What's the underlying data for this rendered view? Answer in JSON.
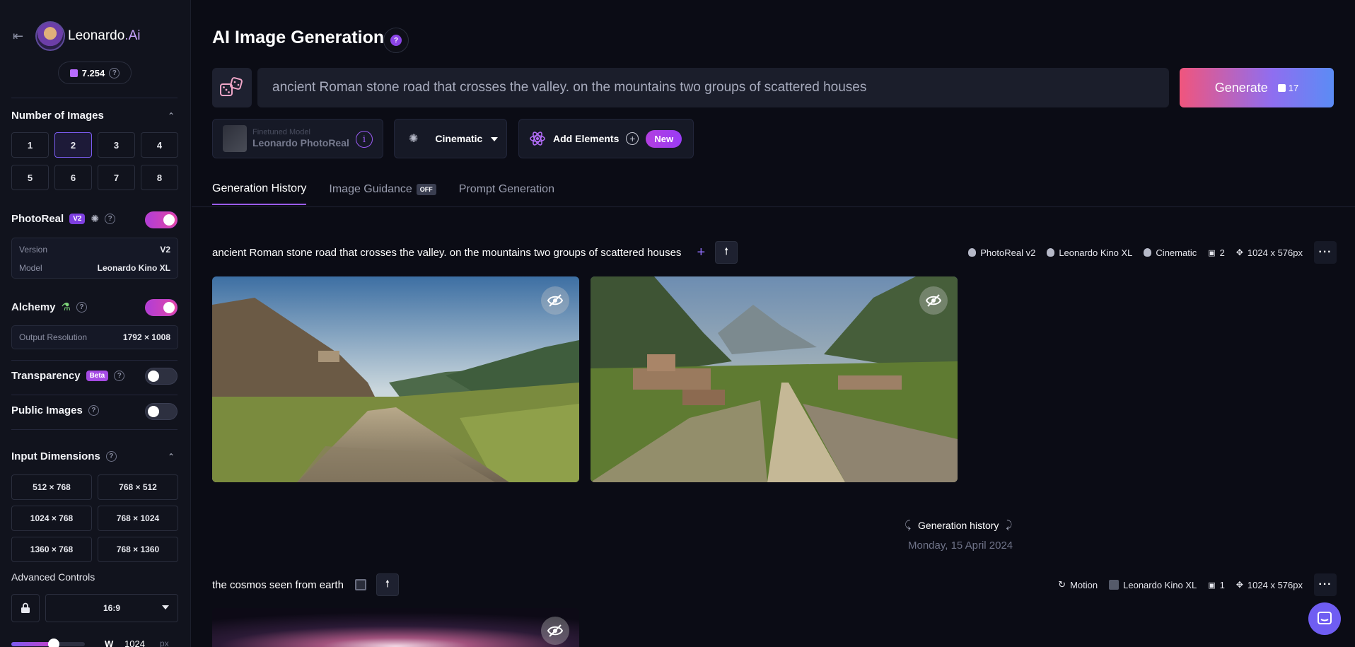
{
  "sidebar": {
    "brand": "Leonardo",
    "brand_suffix": ".Ai",
    "credits": "7.254",
    "num_images": {
      "title": "Number of Images",
      "options": [
        "1",
        "2",
        "3",
        "4",
        "5",
        "6",
        "7",
        "8"
      ],
      "selected": "2"
    },
    "photoreal": {
      "label": "PhotoReal",
      "badge": "V2",
      "on": true,
      "version_key": "Version",
      "version_val": "V2",
      "model_key": "Model",
      "model_val": "Leonardo Kino XL"
    },
    "alchemy": {
      "label": "Alchemy",
      "on": true,
      "res_key": "Output Resolution",
      "res_val": "1792 × 1008"
    },
    "transparency": {
      "label": "Transparency",
      "badge": "Beta",
      "on": false
    },
    "public_images": {
      "label": "Public Images",
      "on": false
    },
    "input_dimensions": {
      "title": "Input Dimensions",
      "options": [
        "512 × 768",
        "768 × 512",
        "1024 × 768",
        "768 × 1024",
        "1360 × 768",
        "768 × 1360"
      ]
    },
    "advanced": {
      "title": "Advanced Controls",
      "ratio": "16:9",
      "w_label": "W",
      "w_value": "1024",
      "w_unit": "px"
    }
  },
  "header": {
    "title": "AI Image Generation",
    "help": "?",
    "prompt": "ancient Roman stone road that crosses the valley. on the mountains two groups of scattered houses",
    "generate_label": "Generate",
    "generate_cost": "17"
  },
  "controls": {
    "model_label": "Finetuned Model",
    "model_name": "Leonardo PhotoReal",
    "style": "Cinematic",
    "elements": "Add Elements",
    "new_badge": "New"
  },
  "tabs": [
    {
      "label": "Generation History",
      "active": true
    },
    {
      "label": "Image Guidance",
      "badge": "OFF"
    },
    {
      "label": "Prompt Generation"
    }
  ],
  "generations": [
    {
      "prompt": "ancient Roman stone road that crosses the valley. on the mountains two groups of scattered houses",
      "meta": {
        "m1": "PhotoReal v2",
        "m2": "Leonardo Kino XL",
        "m3": "Cinematic",
        "count": "2",
        "size": "1024 x 576px"
      }
    },
    {
      "prompt": "the cosmos seen from earth",
      "meta": {
        "m1": "Motion",
        "m2": "Leonardo Kino XL",
        "count": "1",
        "size": "1024 x 576px"
      }
    }
  ],
  "history": {
    "label": "Generation history",
    "date": "Monday, 15 April 2024"
  },
  "colors": {
    "accent": "#9b5cf5",
    "generate_start": "#f0557d",
    "generate_end": "#5b8cf5",
    "bg": "#0b0c15",
    "sidebar_bg": "#11131d"
  }
}
